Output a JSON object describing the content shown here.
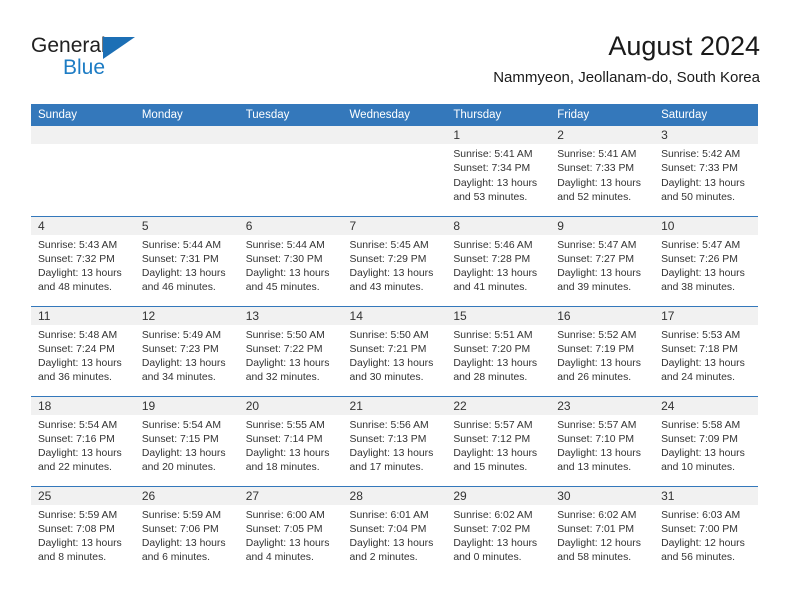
{
  "brand": {
    "line1": "General",
    "line2": "Blue",
    "triangle_color": "#1c6fb5",
    "blue_text_color": "#1d7cc4"
  },
  "header": {
    "title": "August 2024",
    "subtitle": "Nammyeon, Jeollanam-do, South Korea",
    "header_bg": "#3478bb",
    "daynum_bg": "#f1f1f1"
  },
  "weekdays": [
    "Sunday",
    "Monday",
    "Tuesday",
    "Wednesday",
    "Thursday",
    "Friday",
    "Saturday"
  ],
  "weeks": [
    [
      {
        "day": "",
        "sunrise": "",
        "sunset": "",
        "daylight1": "",
        "daylight2": ""
      },
      {
        "day": "",
        "sunrise": "",
        "sunset": "",
        "daylight1": "",
        "daylight2": ""
      },
      {
        "day": "",
        "sunrise": "",
        "sunset": "",
        "daylight1": "",
        "daylight2": ""
      },
      {
        "day": "",
        "sunrise": "",
        "sunset": "",
        "daylight1": "",
        "daylight2": ""
      },
      {
        "day": "1",
        "sunrise": "Sunrise: 5:41 AM",
        "sunset": "Sunset: 7:34 PM",
        "daylight1": "Daylight: 13 hours",
        "daylight2": "and 53 minutes."
      },
      {
        "day": "2",
        "sunrise": "Sunrise: 5:41 AM",
        "sunset": "Sunset: 7:33 PM",
        "daylight1": "Daylight: 13 hours",
        "daylight2": "and 52 minutes."
      },
      {
        "day": "3",
        "sunrise": "Sunrise: 5:42 AM",
        "sunset": "Sunset: 7:33 PM",
        "daylight1": "Daylight: 13 hours",
        "daylight2": "and 50 minutes."
      }
    ],
    [
      {
        "day": "4",
        "sunrise": "Sunrise: 5:43 AM",
        "sunset": "Sunset: 7:32 PM",
        "daylight1": "Daylight: 13 hours",
        "daylight2": "and 48 minutes."
      },
      {
        "day": "5",
        "sunrise": "Sunrise: 5:44 AM",
        "sunset": "Sunset: 7:31 PM",
        "daylight1": "Daylight: 13 hours",
        "daylight2": "and 46 minutes."
      },
      {
        "day": "6",
        "sunrise": "Sunrise: 5:44 AM",
        "sunset": "Sunset: 7:30 PM",
        "daylight1": "Daylight: 13 hours",
        "daylight2": "and 45 minutes."
      },
      {
        "day": "7",
        "sunrise": "Sunrise: 5:45 AM",
        "sunset": "Sunset: 7:29 PM",
        "daylight1": "Daylight: 13 hours",
        "daylight2": "and 43 minutes."
      },
      {
        "day": "8",
        "sunrise": "Sunrise: 5:46 AM",
        "sunset": "Sunset: 7:28 PM",
        "daylight1": "Daylight: 13 hours",
        "daylight2": "and 41 minutes."
      },
      {
        "day": "9",
        "sunrise": "Sunrise: 5:47 AM",
        "sunset": "Sunset: 7:27 PM",
        "daylight1": "Daylight: 13 hours",
        "daylight2": "and 39 minutes."
      },
      {
        "day": "10",
        "sunrise": "Sunrise: 5:47 AM",
        "sunset": "Sunset: 7:26 PM",
        "daylight1": "Daylight: 13 hours",
        "daylight2": "and 38 minutes."
      }
    ],
    [
      {
        "day": "11",
        "sunrise": "Sunrise: 5:48 AM",
        "sunset": "Sunset: 7:24 PM",
        "daylight1": "Daylight: 13 hours",
        "daylight2": "and 36 minutes."
      },
      {
        "day": "12",
        "sunrise": "Sunrise: 5:49 AM",
        "sunset": "Sunset: 7:23 PM",
        "daylight1": "Daylight: 13 hours",
        "daylight2": "and 34 minutes."
      },
      {
        "day": "13",
        "sunrise": "Sunrise: 5:50 AM",
        "sunset": "Sunset: 7:22 PM",
        "daylight1": "Daylight: 13 hours",
        "daylight2": "and 32 minutes."
      },
      {
        "day": "14",
        "sunrise": "Sunrise: 5:50 AM",
        "sunset": "Sunset: 7:21 PM",
        "daylight1": "Daylight: 13 hours",
        "daylight2": "and 30 minutes."
      },
      {
        "day": "15",
        "sunrise": "Sunrise: 5:51 AM",
        "sunset": "Sunset: 7:20 PM",
        "daylight1": "Daylight: 13 hours",
        "daylight2": "and 28 minutes."
      },
      {
        "day": "16",
        "sunrise": "Sunrise: 5:52 AM",
        "sunset": "Sunset: 7:19 PM",
        "daylight1": "Daylight: 13 hours",
        "daylight2": "and 26 minutes."
      },
      {
        "day": "17",
        "sunrise": "Sunrise: 5:53 AM",
        "sunset": "Sunset: 7:18 PM",
        "daylight1": "Daylight: 13 hours",
        "daylight2": "and 24 minutes."
      }
    ],
    [
      {
        "day": "18",
        "sunrise": "Sunrise: 5:54 AM",
        "sunset": "Sunset: 7:16 PM",
        "daylight1": "Daylight: 13 hours",
        "daylight2": "and 22 minutes."
      },
      {
        "day": "19",
        "sunrise": "Sunrise: 5:54 AM",
        "sunset": "Sunset: 7:15 PM",
        "daylight1": "Daylight: 13 hours",
        "daylight2": "and 20 minutes."
      },
      {
        "day": "20",
        "sunrise": "Sunrise: 5:55 AM",
        "sunset": "Sunset: 7:14 PM",
        "daylight1": "Daylight: 13 hours",
        "daylight2": "and 18 minutes."
      },
      {
        "day": "21",
        "sunrise": "Sunrise: 5:56 AM",
        "sunset": "Sunset: 7:13 PM",
        "daylight1": "Daylight: 13 hours",
        "daylight2": "and 17 minutes."
      },
      {
        "day": "22",
        "sunrise": "Sunrise: 5:57 AM",
        "sunset": "Sunset: 7:12 PM",
        "daylight1": "Daylight: 13 hours",
        "daylight2": "and 15 minutes."
      },
      {
        "day": "23",
        "sunrise": "Sunrise: 5:57 AM",
        "sunset": "Sunset: 7:10 PM",
        "daylight1": "Daylight: 13 hours",
        "daylight2": "and 13 minutes."
      },
      {
        "day": "24",
        "sunrise": "Sunrise: 5:58 AM",
        "sunset": "Sunset: 7:09 PM",
        "daylight1": "Daylight: 13 hours",
        "daylight2": "and 10 minutes."
      }
    ],
    [
      {
        "day": "25",
        "sunrise": "Sunrise: 5:59 AM",
        "sunset": "Sunset: 7:08 PM",
        "daylight1": "Daylight: 13 hours",
        "daylight2": "and 8 minutes."
      },
      {
        "day": "26",
        "sunrise": "Sunrise: 5:59 AM",
        "sunset": "Sunset: 7:06 PM",
        "daylight1": "Daylight: 13 hours",
        "daylight2": "and 6 minutes."
      },
      {
        "day": "27",
        "sunrise": "Sunrise: 6:00 AM",
        "sunset": "Sunset: 7:05 PM",
        "daylight1": "Daylight: 13 hours",
        "daylight2": "and 4 minutes."
      },
      {
        "day": "28",
        "sunrise": "Sunrise: 6:01 AM",
        "sunset": "Sunset: 7:04 PM",
        "daylight1": "Daylight: 13 hours",
        "daylight2": "and 2 minutes."
      },
      {
        "day": "29",
        "sunrise": "Sunrise: 6:02 AM",
        "sunset": "Sunset: 7:02 PM",
        "daylight1": "Daylight: 13 hours",
        "daylight2": "and 0 minutes."
      },
      {
        "day": "30",
        "sunrise": "Sunrise: 6:02 AM",
        "sunset": "Sunset: 7:01 PM",
        "daylight1": "Daylight: 12 hours",
        "daylight2": "and 58 minutes."
      },
      {
        "day": "31",
        "sunrise": "Sunrise: 6:03 AM",
        "sunset": "Sunset: 7:00 PM",
        "daylight1": "Daylight: 12 hours",
        "daylight2": "and 56 minutes."
      }
    ]
  ]
}
